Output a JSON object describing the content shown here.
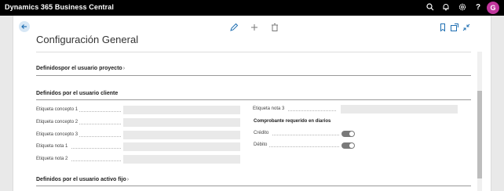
{
  "topbar": {
    "brand": "Dynamics 365 Business Central",
    "avatar_initial": "G",
    "icons": [
      "search-icon",
      "bell-icon",
      "gear-icon",
      "help-icon"
    ]
  },
  "actions": {
    "icons": [
      "edit-icon",
      "new-icon",
      "delete-icon",
      "bookmark-icon",
      "open-new-window-icon",
      "collapse-icon"
    ]
  },
  "page": {
    "title": "Configuración General"
  },
  "sections": {
    "proyecto": {
      "title": "Definidospor el usuario proyecto",
      "chevron": "›"
    },
    "cliente": {
      "title": "Definidos por el usuario cliente",
      "left_fields": [
        {
          "label": "Etiqueta concepto 1",
          "value": ""
        },
        {
          "label": "Etiqueta concepto 2",
          "value": ""
        },
        {
          "label": "Etiqueta concepto 3",
          "value": ""
        },
        {
          "label": "Etiqueta nota 1",
          "value": ""
        },
        {
          "label": "Etiqueta nota 2",
          "value": ""
        }
      ],
      "right_field": {
        "label": "Etiqueta nota 3",
        "value": ""
      },
      "diarios_heading": "Comprobante requerido en diarios",
      "toggles": [
        {
          "label": "Crédito",
          "on": true
        },
        {
          "label": "Débito",
          "on": true
        }
      ]
    },
    "activo_fijo": {
      "title": "Definidos por el usuario activo fijo",
      "chevron": "›"
    }
  },
  "colors": {
    "topbar": "#000000",
    "accent": "#1f6fb2",
    "avatar": "#c1369d"
  }
}
